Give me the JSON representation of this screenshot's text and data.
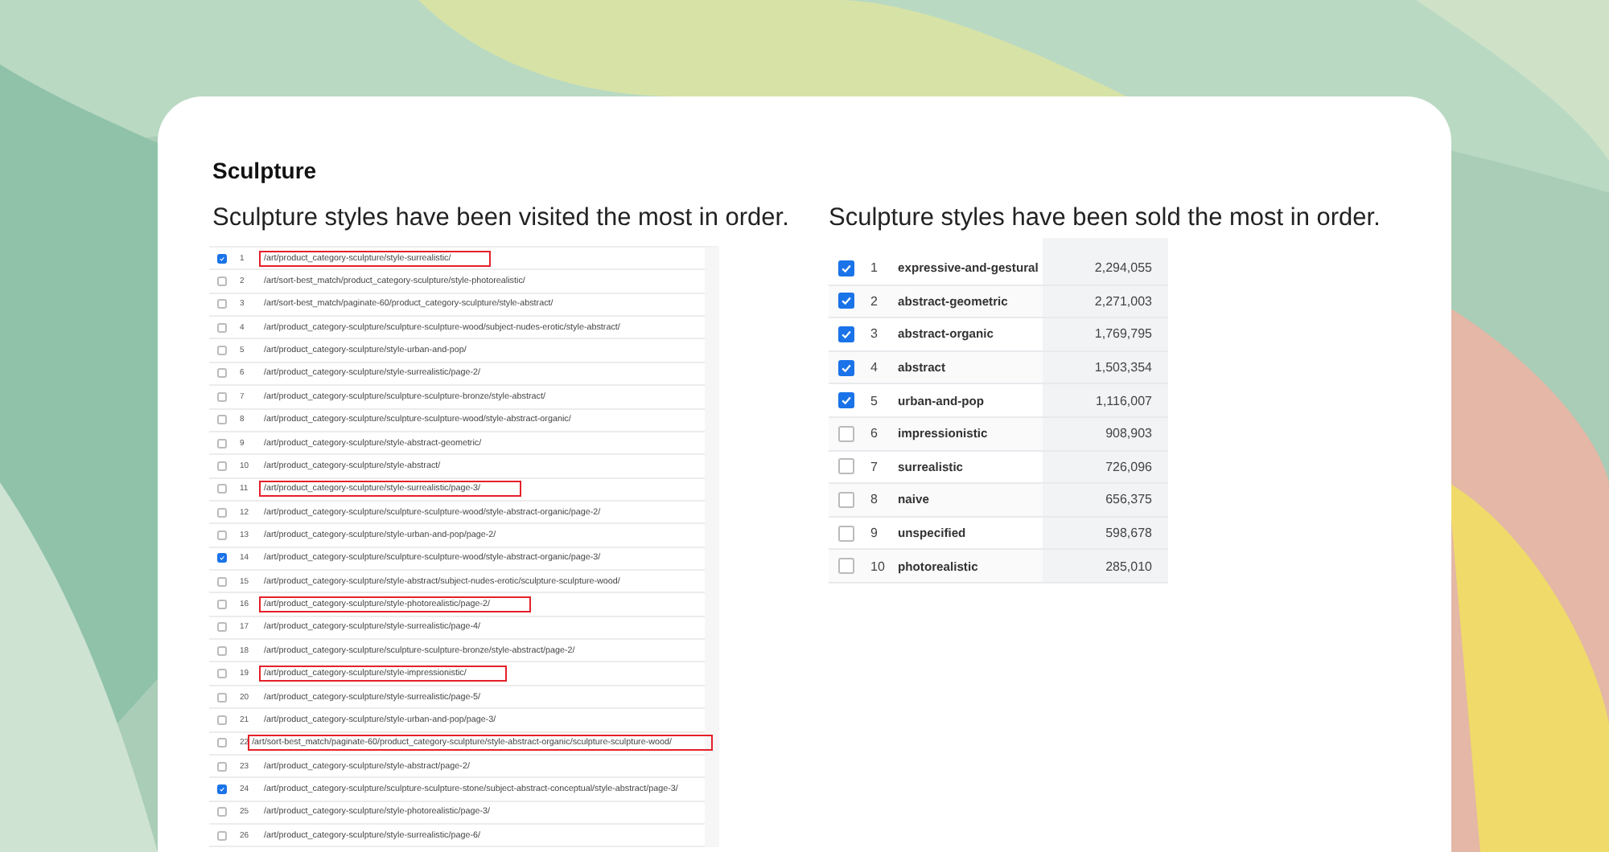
{
  "section_title": "Sculpture",
  "visited": {
    "caption": "Sculpture styles have been visited the most in order.",
    "rows": [
      {
        "rank": "1",
        "url": "/art/product_category-sculpture/style-surrealistic/",
        "checked": true,
        "highlighted": true
      },
      {
        "rank": "2",
        "url": "/art/sort-best_match/product_category-sculpture/style-photorealistic/",
        "checked": false,
        "highlighted": false
      },
      {
        "rank": "3",
        "url": "/art/sort-best_match/paginate-60/product_category-sculpture/style-abstract/",
        "checked": false,
        "highlighted": false
      },
      {
        "rank": "4",
        "url": "/art/product_category-sculpture/sculpture-sculpture-wood/subject-nudes-erotic/style-abstract/",
        "checked": false,
        "highlighted": false
      },
      {
        "rank": "5",
        "url": "/art/product_category-sculpture/style-urban-and-pop/",
        "checked": false,
        "highlighted": false
      },
      {
        "rank": "6",
        "url": "/art/product_category-sculpture/style-surrealistic/page-2/",
        "checked": false,
        "highlighted": false
      },
      {
        "rank": "7",
        "url": "/art/product_category-sculpture/sculpture-sculpture-bronze/style-abstract/",
        "checked": false,
        "highlighted": false
      },
      {
        "rank": "8",
        "url": "/art/product_category-sculpture/sculpture-sculpture-wood/style-abstract-organic/",
        "checked": false,
        "highlighted": false
      },
      {
        "rank": "9",
        "url": "/art/product_category-sculpture/style-abstract-geometric/",
        "checked": false,
        "highlighted": false
      },
      {
        "rank": "10",
        "url": "/art/product_category-sculpture/style-abstract/",
        "checked": false,
        "highlighted": false
      },
      {
        "rank": "11",
        "url": "/art/product_category-sculpture/style-surrealistic/page-3/",
        "checked": false,
        "highlighted": true
      },
      {
        "rank": "12",
        "url": "/art/product_category-sculpture/sculpture-sculpture-wood/style-abstract-organic/page-2/",
        "checked": false,
        "highlighted": false
      },
      {
        "rank": "13",
        "url": "/art/product_category-sculpture/style-urban-and-pop/page-2/",
        "checked": false,
        "highlighted": false
      },
      {
        "rank": "14",
        "url": "/art/product_category-sculpture/sculpture-sculpture-wood/style-abstract-organic/page-3/",
        "checked": true,
        "highlighted": false
      },
      {
        "rank": "15",
        "url": "/art/product_category-sculpture/style-abstract/subject-nudes-erotic/sculpture-sculpture-wood/",
        "checked": false,
        "highlighted": false
      },
      {
        "rank": "16",
        "url": "/art/product_category-sculpture/style-photorealistic/page-2/",
        "checked": false,
        "highlighted": true
      },
      {
        "rank": "17",
        "url": "/art/product_category-sculpture/style-surrealistic/page-4/",
        "checked": false,
        "highlighted": false
      },
      {
        "rank": "18",
        "url": "/art/product_category-sculpture/sculpture-sculpture-bronze/style-abstract/page-2/",
        "checked": false,
        "highlighted": false
      },
      {
        "rank": "19",
        "url": "/art/product_category-sculpture/style-impressionistic/",
        "checked": false,
        "highlighted": true
      },
      {
        "rank": "20",
        "url": "/art/product_category-sculpture/style-surrealistic/page-5/",
        "checked": false,
        "highlighted": false
      },
      {
        "rank": "21",
        "url": "/art/product_category-sculpture/style-urban-and-pop/page-3/",
        "checked": false,
        "highlighted": false
      },
      {
        "rank": "22",
        "url": "/art/sort-best_match/paginate-60/product_category-sculpture/style-abstract-organic/sculpture-sculpture-wood/",
        "checked": false,
        "highlighted": true
      },
      {
        "rank": "23",
        "url": "/art/product_category-sculpture/style-abstract/page-2/",
        "checked": false,
        "highlighted": false
      },
      {
        "rank": "24",
        "url": "/art/product_category-sculpture/sculpture-sculpture-stone/subject-abstract-conceptual/style-abstract/page-3/",
        "checked": true,
        "highlighted": false
      },
      {
        "rank": "25",
        "url": "/art/product_category-sculpture/style-photorealistic/page-3/",
        "checked": false,
        "highlighted": false
      },
      {
        "rank": "26",
        "url": "/art/product_category-sculpture/style-surrealistic/page-6/",
        "checked": false,
        "highlighted": false
      }
    ]
  },
  "sold": {
    "caption": "Sculpture styles have been sold the most in order.",
    "rows": [
      {
        "rank": "1",
        "style": "expressive-and-gestural",
        "value": "2,294,055",
        "checked": true
      },
      {
        "rank": "2",
        "style": "abstract-geometric",
        "value": "2,271,003",
        "checked": true
      },
      {
        "rank": "3",
        "style": "abstract-organic",
        "value": "1,769,795",
        "checked": true
      },
      {
        "rank": "4",
        "style": "abstract",
        "value": "1,503,354",
        "checked": true
      },
      {
        "rank": "5",
        "style": "urban-and-pop",
        "value": "1,116,007",
        "checked": true
      },
      {
        "rank": "6",
        "style": "impressionistic",
        "value": "908,903",
        "checked": false
      },
      {
        "rank": "7",
        "style": "surrealistic",
        "value": "726,096",
        "checked": false
      },
      {
        "rank": "8",
        "style": "naive",
        "value": "656,375",
        "checked": false
      },
      {
        "rank": "9",
        "style": "unspecified",
        "value": "598,678",
        "checked": false
      },
      {
        "rank": "10",
        "style": "photorealistic",
        "value": "285,010",
        "checked": false
      }
    ]
  }
}
